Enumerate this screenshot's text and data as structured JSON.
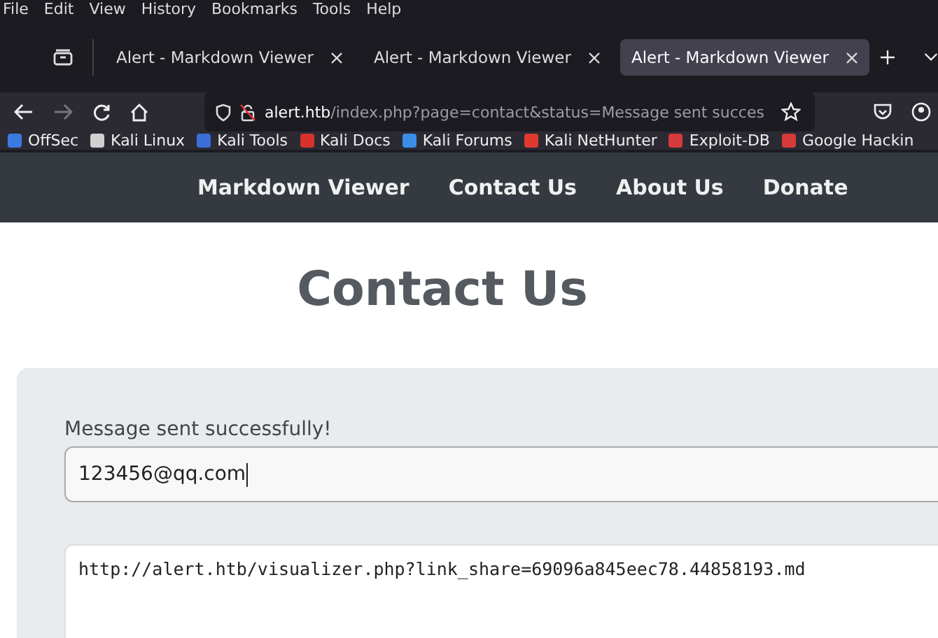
{
  "menu_bar": [
    "File",
    "Edit",
    "View",
    "History",
    "Bookmarks",
    "Tools",
    "Help"
  ],
  "tabs": [
    {
      "label": "Alert - Markdown Viewer",
      "selected": false
    },
    {
      "label": "Alert - Markdown Viewer",
      "selected": false
    },
    {
      "label": "Alert - Markdown Viewer",
      "selected": true
    }
  ],
  "address_bar": {
    "host": "alert.htb",
    "path": "/index.php?page=contact&status=Message sent succes"
  },
  "bookmarks": [
    {
      "label": "OffSec",
      "color": "#3b7be0"
    },
    {
      "label": "Kali Linux",
      "color": "#d0d0d0"
    },
    {
      "label": "Kali Tools",
      "color": "#3b6fd8"
    },
    {
      "label": "Kali Docs",
      "color": "#d8322d"
    },
    {
      "label": "Kali Forums",
      "color": "#3a8ee6"
    },
    {
      "label": "Kali NetHunter",
      "color": "#e0392f"
    },
    {
      "label": "Exploit-DB",
      "color": "#d63a3a"
    },
    {
      "label": "Google Hackin",
      "color": "#d63a3a"
    }
  ],
  "site_nav": [
    "Markdown Viewer",
    "Contact Us",
    "About Us",
    "Donate"
  ],
  "heading": "Contact Us",
  "form": {
    "status_message": "Message sent successfully!",
    "email_value": "123456@qq.com",
    "message_value": "http://alert.htb/visualizer.php?link_share=69096a845eec78.44858193.md"
  }
}
